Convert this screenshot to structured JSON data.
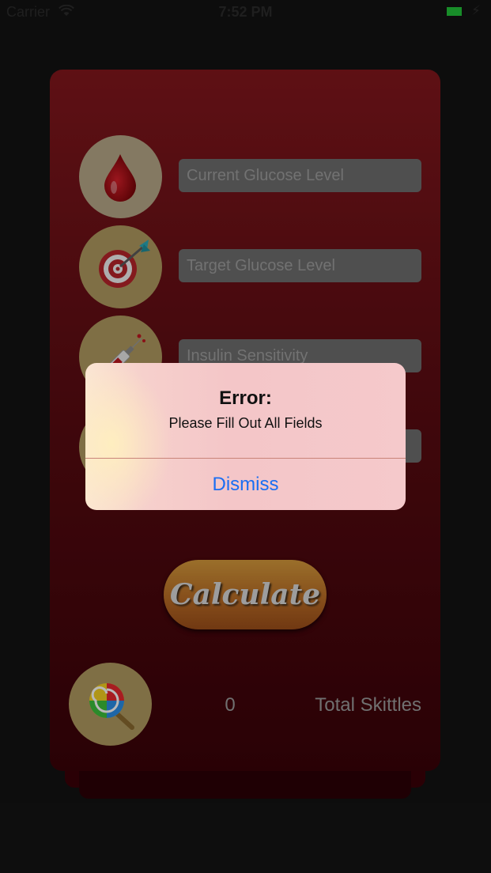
{
  "status_bar": {
    "carrier": "Carrier",
    "time": "7:52 PM",
    "battery_color": "#22c43a"
  },
  "form": {
    "fields": [
      {
        "icon": "blood-drop-icon",
        "placeholder": "Current Glucose Level",
        "value": ""
      },
      {
        "icon": "target-dart-icon",
        "placeholder": "Target Glucose Level",
        "value": ""
      },
      {
        "icon": "syringe-icon",
        "placeholder": "Insulin Sensitivity",
        "value": ""
      },
      {
        "icon": "unknown-icon",
        "placeholder": "",
        "value": ""
      }
    ],
    "calculate_label": "Calculate"
  },
  "result": {
    "icon": "lollipop-icon",
    "count": "0",
    "label": "Total Skittles"
  },
  "alert": {
    "title": "Error:",
    "message": "Please Fill Out All Fields",
    "button": "Dismiss",
    "button_color": "#1a6ef3"
  },
  "colors": {
    "card_top": "#83171d",
    "card_bottom": "#3a0208",
    "calculate_button": "#c07a2c"
  }
}
